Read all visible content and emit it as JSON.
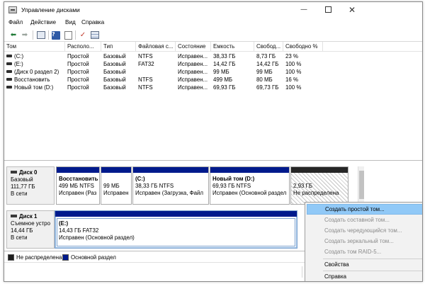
{
  "window": {
    "title": "Управление дисками",
    "minimize_glyph": "—",
    "maximize_glyph": "",
    "close_glyph": "✕"
  },
  "menu": [
    "Файл",
    "Действие",
    "Вид",
    "Справка"
  ],
  "toolbar_icons": [
    "back-icon",
    "forward-icon",
    "properties-icon",
    "help-icon",
    "document-icon",
    "check-icon",
    "list-icon"
  ],
  "toolbar_glyphs": {
    "back": "⬅",
    "forward": "➡",
    "help": "?",
    "check": "✓"
  },
  "table": {
    "columns": [
      "Том",
      "Располо...",
      "Тип",
      "Файловая с...",
      "Состояние",
      "Емкость",
      "Свобод...",
      "Свободно %"
    ],
    "rows": [
      [
        "(C:)",
        "Простой",
        "Базовый",
        "NTFS",
        "Исправен...",
        "38,33 ГБ",
        "8,73 ГБ",
        "23 %"
      ],
      [
        "(E:)",
        "Простой",
        "Базовый",
        "FAT32",
        "Исправен...",
        "14,42 ГБ",
        "14,42 ГБ",
        "100 %"
      ],
      [
        "(Диск 0 раздел 2)",
        "Простой",
        "Базовый",
        "",
        "Исправен...",
        "99 МБ",
        "99 МБ",
        "100 %"
      ],
      [
        "Восстановить",
        "Простой",
        "Базовый",
        "NTFS",
        "Исправен...",
        "499 МБ",
        "80 МБ",
        "16 %"
      ],
      [
        "Новый том (D:)",
        "Простой",
        "Базовый",
        "NTFS",
        "Исправен...",
        "69,93 ГБ",
        "69,73 ГБ",
        "100 %"
      ]
    ]
  },
  "disks": [
    {
      "name": "Диск 0",
      "type": "Базовый",
      "size": "111,77 ГБ",
      "status": "В сети",
      "partitions": [
        {
          "title": "Восстановить",
          "line1": "499 МБ NTFS",
          "line2": "Исправен (Раз"
        },
        {
          "title": "",
          "line1": "99 МБ",
          "line2": "Исправен"
        },
        {
          "title": "(C:)",
          "line1": "38,33 ГБ NTFS",
          "line2": "Исправен (Загрузка, Файл"
        },
        {
          "title": "Новый том  (D:)",
          "line1": "69,93 ГБ NTFS",
          "line2": "Исправен (Основной раздел"
        },
        {
          "title": "",
          "line1": "2,93 ГБ",
          "line2": "Не распределена"
        }
      ]
    },
    {
      "name": "Диск 1",
      "type": "Съемное устро",
      "size": "14,44 ГБ",
      "status": "В сети",
      "partitions": [
        {
          "title": "(E:)",
          "line1": "14,43 ГБ FAT32",
          "line2": "Исправен (Основной раздел)"
        }
      ]
    }
  ],
  "legend": [
    {
      "label": "Не распределена",
      "color": "#1f1f1f"
    },
    {
      "label": "Основной раздел",
      "color": "#001a8c"
    }
  ],
  "context_menu": [
    {
      "label": "Создать простой том...",
      "enabled": true,
      "highlighted": true
    },
    {
      "label": "Создать составной том...",
      "enabled": false
    },
    {
      "label": "Создать чередующийся том...",
      "enabled": false
    },
    {
      "label": "Создать зеркальный том...",
      "enabled": false
    },
    {
      "label": "Создать том RAID-5...",
      "enabled": false
    },
    {
      "label": "Свойства",
      "enabled": true
    },
    {
      "label": "Справка",
      "enabled": true
    }
  ]
}
